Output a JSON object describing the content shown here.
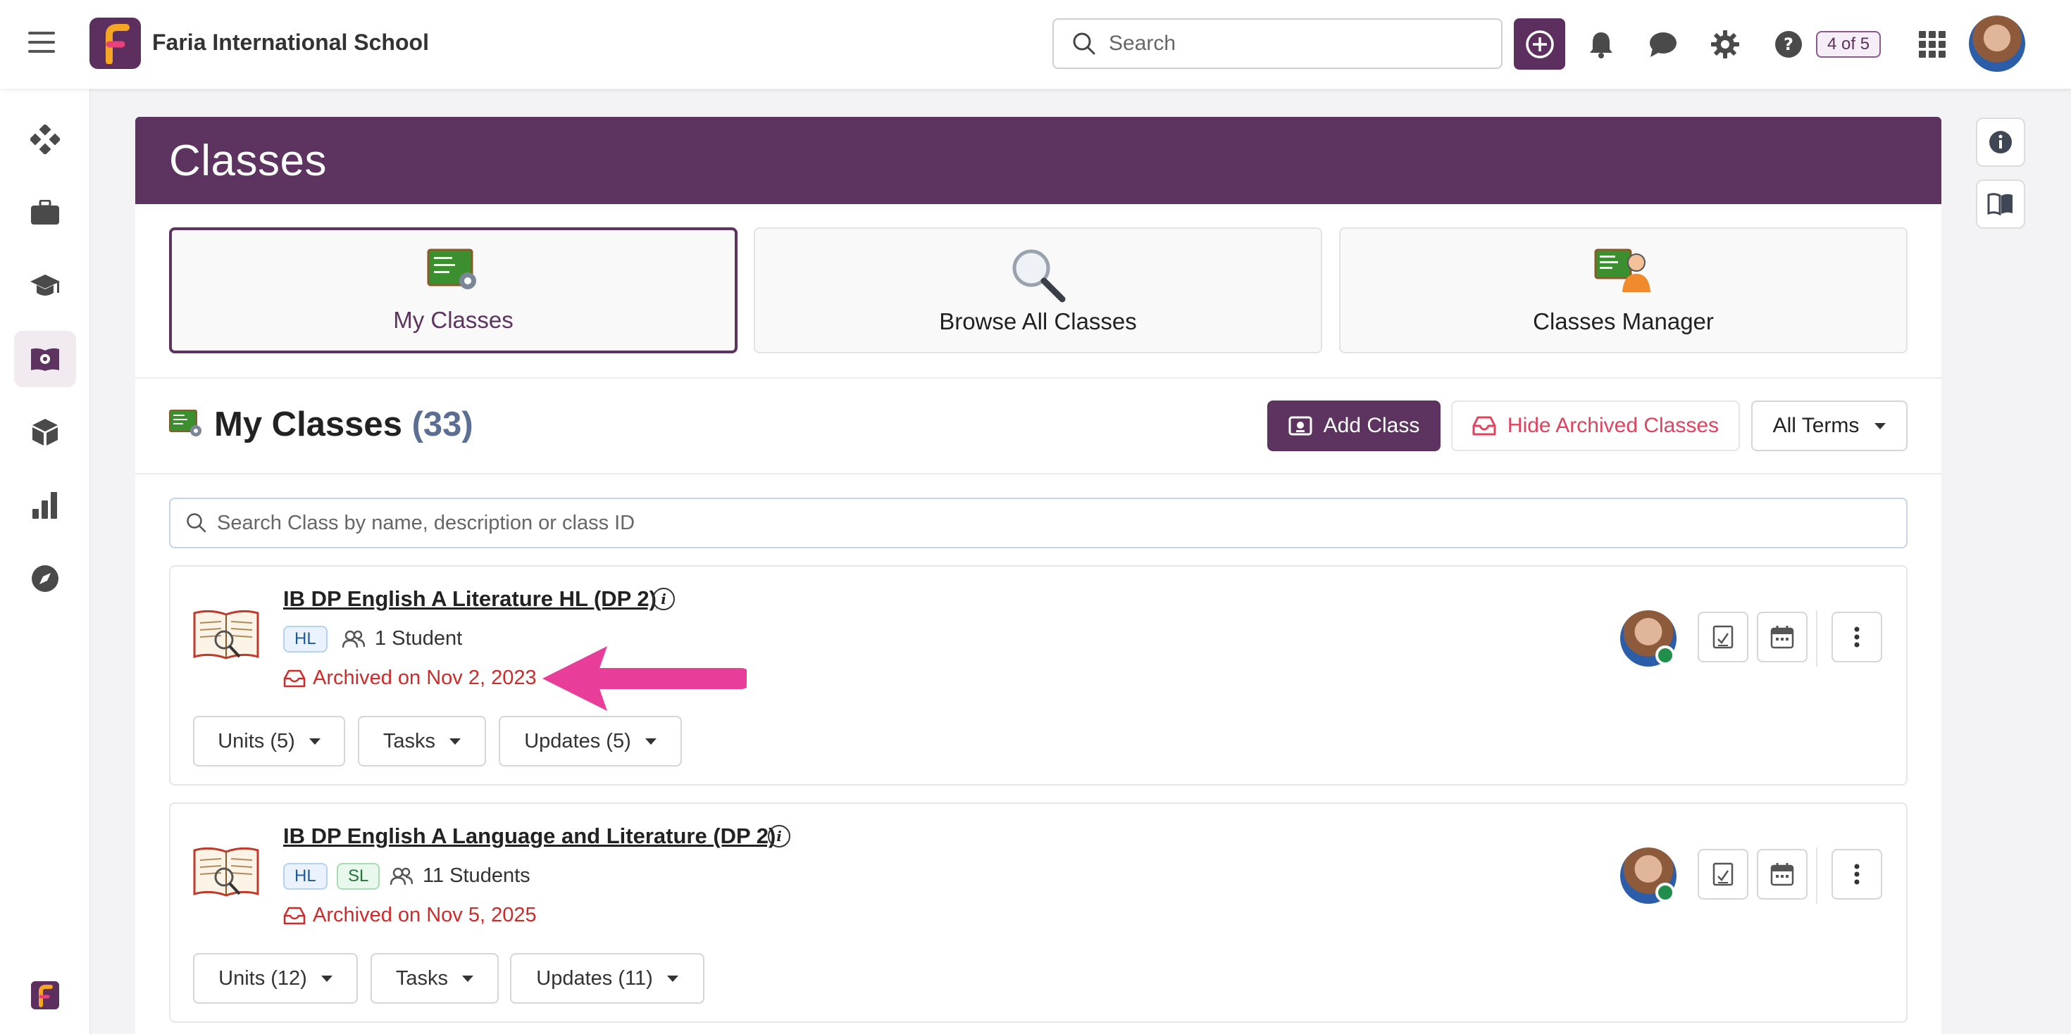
{
  "topbar": {
    "school_name": "Faria International School",
    "search_placeholder": "Search",
    "counter": "4 of 5"
  },
  "page": {
    "title": "Classes"
  },
  "tiles": [
    {
      "label": "My Classes",
      "active": true
    },
    {
      "label": "Browse All Classes",
      "active": false
    },
    {
      "label": "Classes Manager",
      "active": false
    }
  ],
  "section": {
    "title": "My Classes",
    "count": "(33)",
    "add_class": "Add Class",
    "hide_archived": "Hide Archived Classes",
    "terms": "All Terms",
    "class_search_placeholder": "Search Class by name, description or class ID"
  },
  "classes": [
    {
      "title": "IB DP English A Literature HL (DP 2)",
      "tags": [
        "HL"
      ],
      "students": "1 Student",
      "archived": "Archived on Nov 2, 2023",
      "units": "Units (5)",
      "tasks": "Tasks",
      "updates": "Updates (5)"
    },
    {
      "title": "IB DP English A Language and Literature (DP 2)",
      "tags": [
        "HL",
        "SL"
      ],
      "students": "11 Students",
      "archived": "Archived on Nov 5, 2025",
      "units": "Units (12)",
      "tasks": "Tasks",
      "updates": "Updates (11)"
    }
  ],
  "colors": {
    "brand": "#5d3360",
    "archived_red": "#d12a2a",
    "hide_red": "#e1435f",
    "annotation_arrow": "#e83e9a"
  }
}
